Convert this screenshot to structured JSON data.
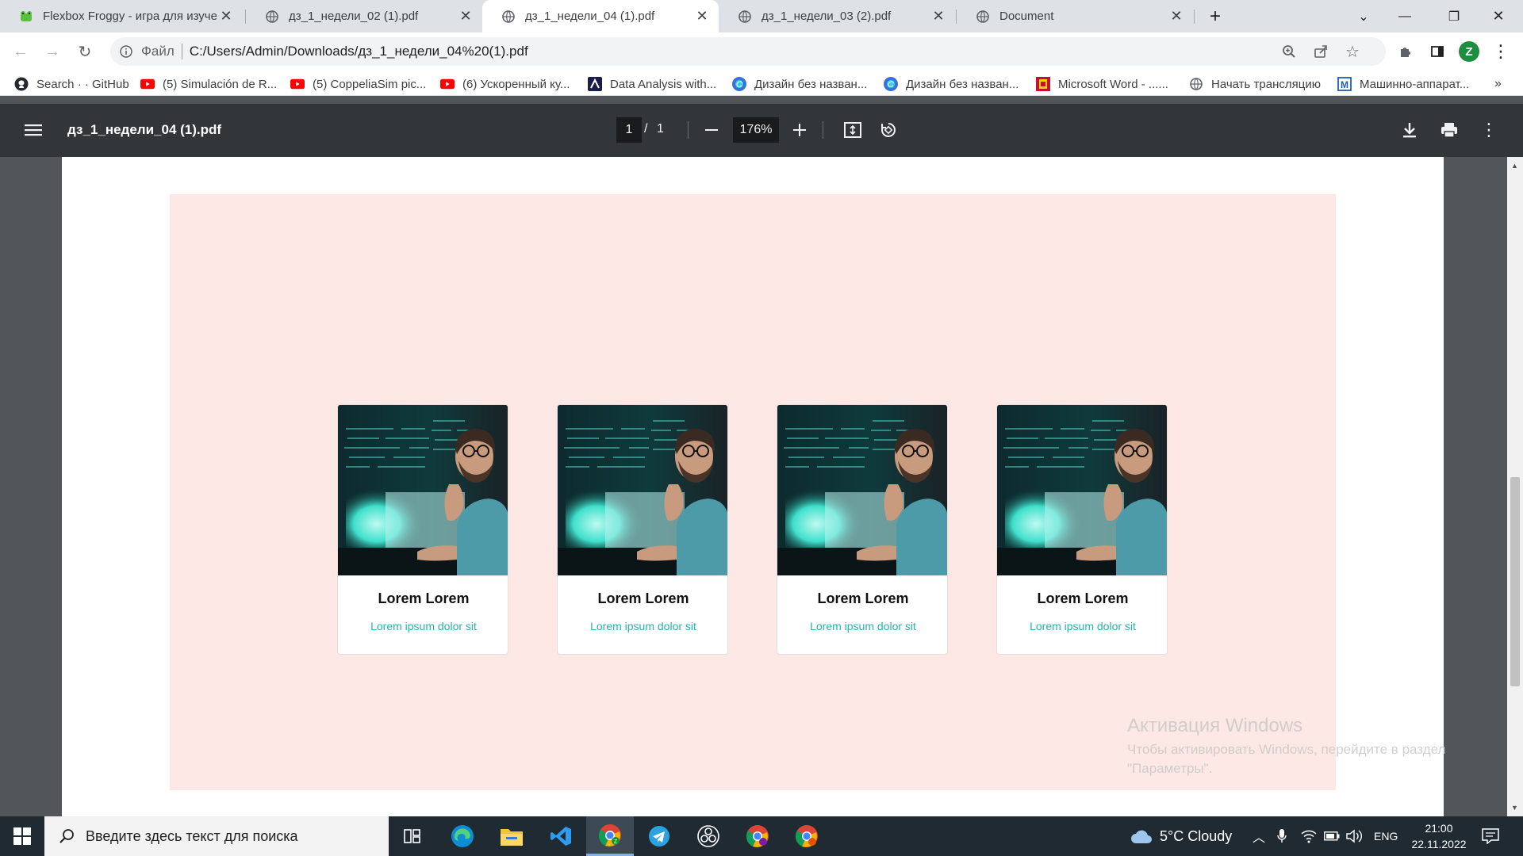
{
  "tabs": [
    {
      "title": "Flexbox Froggy - игра для изуче",
      "icon": "frog-icon",
      "active": false
    },
    {
      "title": "дз_1_недели_02 (1).pdf",
      "icon": "globe-icon",
      "active": false
    },
    {
      "title": "дз_1_недели_04 (1).pdf",
      "icon": "globe-icon",
      "active": true
    },
    {
      "title": "дз_1_недели_03 (2).pdf",
      "icon": "globe-icon",
      "active": false
    },
    {
      "title": "Document",
      "icon": "globe-icon",
      "active": false
    }
  ],
  "omnibox": {
    "scheme_label": "Файл",
    "url": "C:/Users/Admin/Downloads/дз_1_недели_04%20(1).pdf"
  },
  "profile_initial": "Z",
  "bookmarks": [
    {
      "label": "Search · · GitHub",
      "icon": "github-icon"
    },
    {
      "label": "(5) Simulación de R...",
      "icon": "youtube-icon"
    },
    {
      "label": "(5) CoppeliaSim pic...",
      "icon": "youtube-icon"
    },
    {
      "label": "(6) Ускоренный ку...",
      "icon": "youtube-icon"
    },
    {
      "label": "Data Analysis with...",
      "icon": "data-analysis-icon"
    },
    {
      "label": "Дизайн без назван...",
      "icon": "canva-icon"
    },
    {
      "label": "Дизайн без назван...",
      "icon": "canva-icon"
    },
    {
      "label": "Microsoft Word - ......",
      "icon": "word-doc-icon"
    },
    {
      "label": "Начать трансляцию",
      "icon": "globe-icon"
    },
    {
      "label": "Машинно-аппарат...",
      "icon": "m-doc-icon"
    }
  ],
  "bookmarks_more": "»",
  "pdf": {
    "filename": "дз_1_недели_04 (1).pdf",
    "current_page": "1",
    "page_separator": "/",
    "total_pages": "1",
    "zoom": "176%"
  },
  "cards": [
    {
      "title": "Lorem Lorem",
      "subtitle": "Lorem ipsum dolor sit"
    },
    {
      "title": "Lorem Lorem",
      "subtitle": "Lorem ipsum dolor sit"
    },
    {
      "title": "Lorem Lorem",
      "subtitle": "Lorem ipsum dolor sit"
    },
    {
      "title": "Lorem Lorem",
      "subtitle": "Lorem ipsum dolor sit"
    }
  ],
  "watermark": {
    "title": "Активация Windows",
    "line1": "Чтобы активировать Windows, перейдите в раздел",
    "line2": "\"Параметры\"."
  },
  "taskbar": {
    "search_placeholder": "Введите здесь текст для поиска",
    "weather": "5°C  Cloudy",
    "language": "ENG",
    "time": "21:00",
    "date": "22.11.2022"
  },
  "colors": {
    "pink_background": "#fde8e6",
    "subtitle_teal": "#26b4ac",
    "pdf_toolbar": "#323639",
    "taskbar": "#1f2a33"
  }
}
